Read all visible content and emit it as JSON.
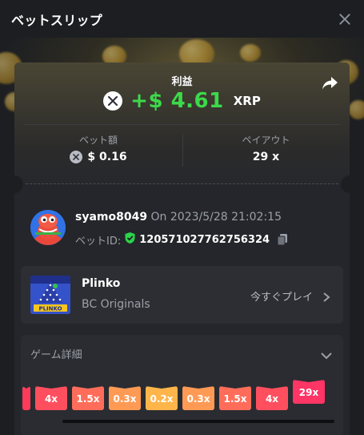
{
  "header": {
    "title": "ベットスリップ"
  },
  "summary": {
    "profit_label": "利益",
    "profit_amount": "+$ 4.61",
    "currency": "XRP",
    "bet_amount_label": "ベット額",
    "bet_amount_value": "$ 0.16",
    "payout_label": "ペイアウト",
    "payout_value": "29 x"
  },
  "user": {
    "username": "syamo8049",
    "timestamp": "On 2023/5/28 21:02:15",
    "bet_id_label": "ベットID:",
    "bet_id_value": "120571027762756324"
  },
  "game": {
    "name": "Plinko",
    "provider": "BC Originals",
    "play_now_label": "今すぐプレイ",
    "thumb_text": "PLINKO"
  },
  "details": {
    "title": "ゲーム詳細",
    "buckets": [
      {
        "label": "",
        "color": "#ff3b5c"
      },
      {
        "label": "4x",
        "color": "#ff4f5e"
      },
      {
        "label": "1.5x",
        "color": "#ff6d5a"
      },
      {
        "label": "0.3x",
        "color": "#ff9a55"
      },
      {
        "label": "0.2x",
        "color": "#ffb54a"
      },
      {
        "label": "0.3x",
        "color": "#ff9a55"
      },
      {
        "label": "1.5x",
        "color": "#ff6d5a"
      },
      {
        "label": "4x",
        "color": "#ff4f5e"
      },
      {
        "label": "29x",
        "color": "#ff3566",
        "hit": true
      }
    ]
  },
  "colors": {
    "profit_green": "#3dd94a",
    "background": "#1c1e22",
    "card": "#24262b",
    "verified_green": "#2bd44a"
  }
}
